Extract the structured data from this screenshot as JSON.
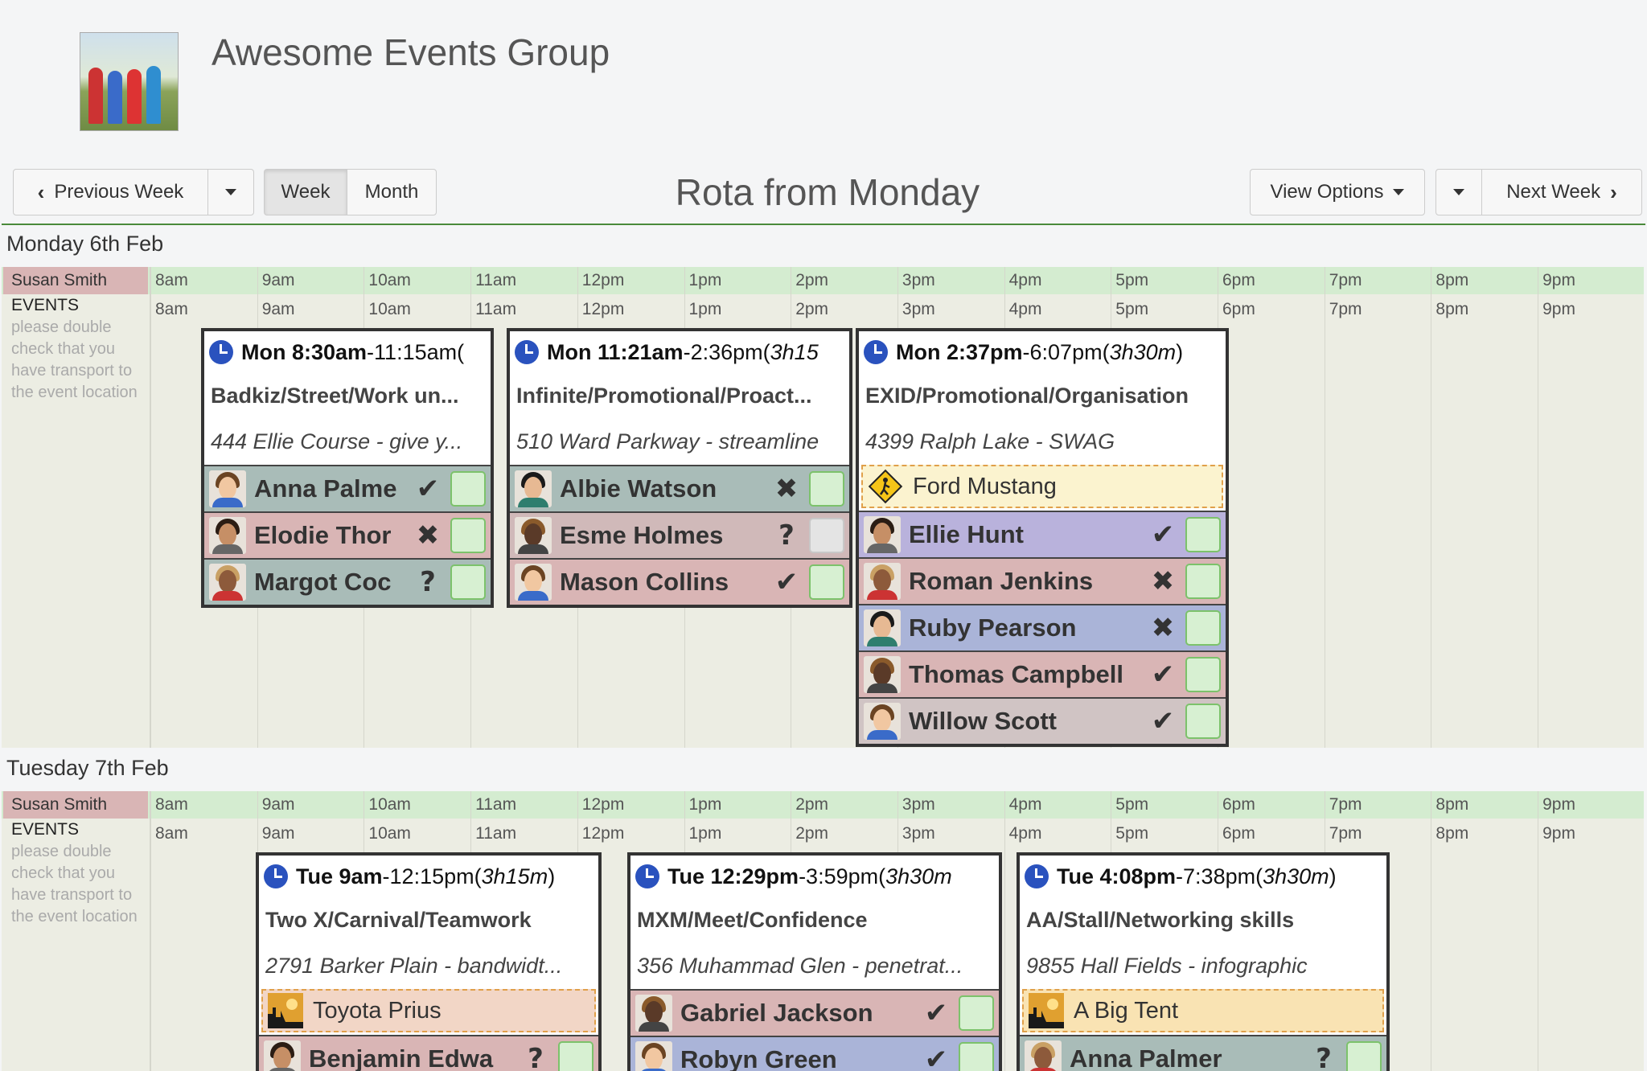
{
  "group": {
    "name": "Awesome Events Group"
  },
  "toolbar": {
    "prev_label": "Previous Week",
    "week_label": "Week",
    "month_label": "Month",
    "title": "Rota from Monday",
    "view_options_label": "View Options",
    "next_label": "Next Week"
  },
  "hours": [
    "8am",
    "9am",
    "10am",
    "11am",
    "12pm",
    "1pm",
    "2pm",
    "3pm",
    "4pm",
    "5pm",
    "6pm",
    "7pm",
    "8pm",
    "9pm"
  ],
  "days": [
    {
      "title": "Monday 6th Feb",
      "person": "Susan Smith",
      "events_label": "EVENTS",
      "events_note": "please double check that you have transport to the event location",
      "events": [
        {
          "time_start": "Mon 8:30am",
          "time_end": "-11:15am",
          "duration": " (",
          "title": "Badkiz/Street/Work un...",
          "location": "444 Ellie Course - give y...",
          "staff": [
            {
              "name": "Anna Palme",
              "status": "✔",
              "color": "#a9bcb8"
            },
            {
              "name": "Elodie Thor",
              "status": "✖",
              "color": "#d9b5b5"
            },
            {
              "name": "Margot Coc",
              "status": "?",
              "color": "#a9bcb8"
            }
          ]
        },
        {
          "time_start": "Mon 11:21am",
          "time_end": "-2:36pm",
          "duration": " (3h15",
          "title": "Infinite/Promotional/Proact...",
          "location": "510 Ward Parkway - streamline",
          "staff": [
            {
              "name": "Albie Watson",
              "status": "✖",
              "color": "#a9bcb8"
            },
            {
              "name": "Esme Holmes",
              "status": "?",
              "color": "#d0b9b9",
              "grey": true
            },
            {
              "name": "Mason Collins",
              "status": "✔",
              "color": "#d9b5b5"
            }
          ]
        },
        {
          "time_start": "Mon 2:37pm",
          "time_end": "-6:07pm",
          "duration": " (3h30m)",
          "title": "EXID/Promotional/Organisation",
          "location": "4399 Ralph Lake - SWAG",
          "resource": {
            "name": "Ford Mustang",
            "bg": "#fbf3cf"
          },
          "staff": [
            {
              "name": "Ellie Hunt",
              "status": "✔",
              "color": "#b9b2dc"
            },
            {
              "name": "Roman Jenkins",
              "status": "✖",
              "color": "#d9b5b5"
            },
            {
              "name": "Ruby Pearson",
              "status": "✖",
              "color": "#aab4d8"
            },
            {
              "name": "Thomas Campbell",
              "status": "✔",
              "color": "#d9b5b5"
            },
            {
              "name": "Willow Scott",
              "status": "✔",
              "color": "#d0c4c4"
            }
          ]
        }
      ]
    },
    {
      "title": "Tuesday 7th Feb",
      "person": "Susan Smith",
      "events_label": "EVENTS",
      "events_note": "please double check that you have transport to the event location",
      "events": [
        {
          "time_start": "Tue 9am",
          "time_end": "-12:15pm",
          "duration": " (3h15m)",
          "title": "Two X/Carnival/Teamwork",
          "location": "2791 Barker Plain - bandwidt...",
          "resource": {
            "name": "Toyota Prius",
            "bg": "#f2d6c6"
          },
          "staff": [
            {
              "name": "Benjamin Edwa",
              "status": "?",
              "color": "#d9b5b5"
            }
          ]
        },
        {
          "time_start": "Tue 12:29pm",
          "time_end": "-3:59pm",
          "duration": " (3h30m",
          "title": "MXM/Meet/Confidence",
          "location": "356 Muhammad Glen - penetrat...",
          "staff": [
            {
              "name": "Gabriel Jackson",
              "status": "✔",
              "color": "#d9b5b5"
            },
            {
              "name": "Robyn Green",
              "status": "✔",
              "color": "#aab4d8"
            }
          ]
        },
        {
          "time_start": "Tue 4:08pm",
          "time_end": "-7:38pm",
          "duration": " (3h30m)",
          "title": "AA/Stall/Networking skills",
          "location": "9855 Hall Fields - infographic",
          "resource": {
            "name": "A Big Tent",
            "bg": "#f9e3b3"
          },
          "staff": [
            {
              "name": "Anna Palmer",
              "status": "?",
              "color": "#a9bcb8"
            }
          ]
        }
      ]
    }
  ]
}
